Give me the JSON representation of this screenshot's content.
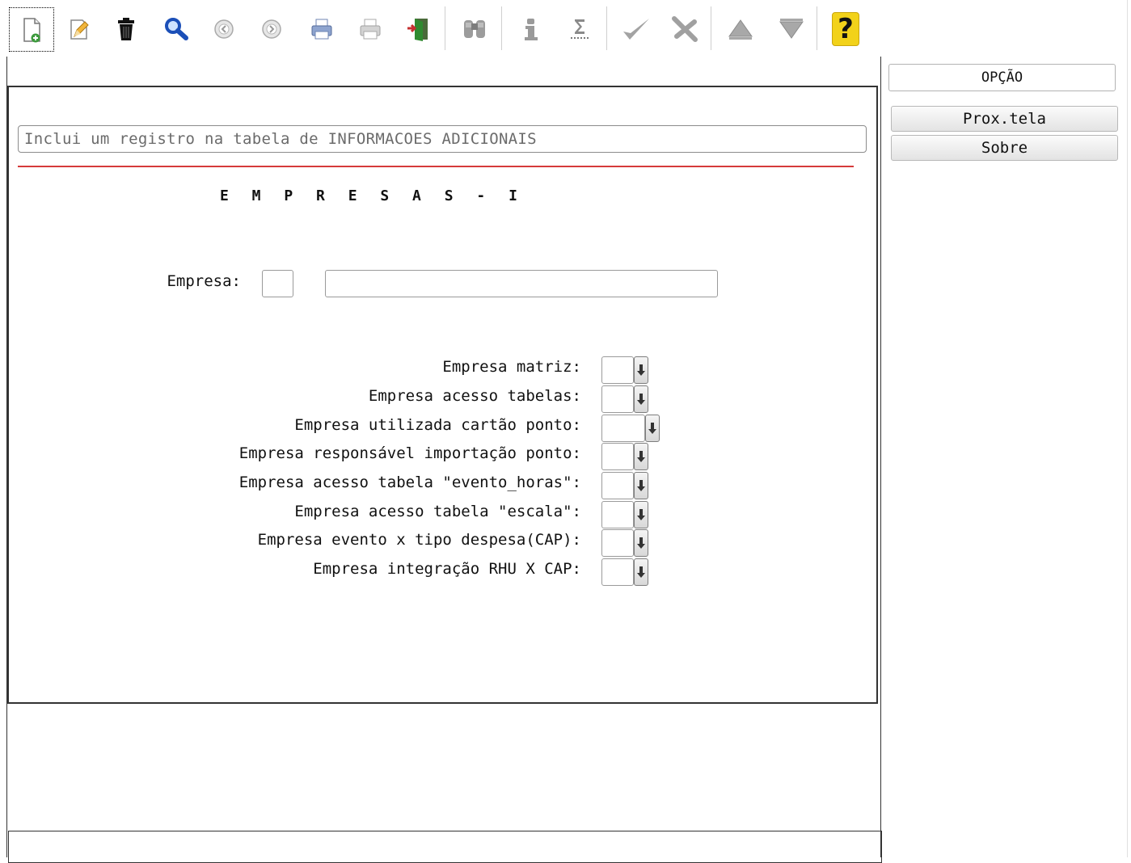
{
  "toolbar": {
    "icons": [
      "new-record-icon",
      "edit-icon",
      "delete-icon",
      "search-icon",
      "previous-icon",
      "next-icon",
      "print-icon",
      "print-preview-icon",
      "exit-icon",
      "binoculars-icon",
      "info-icon",
      "sum-icon",
      "confirm-icon",
      "cancel-icon",
      "first-icon",
      "last-icon",
      "help-icon"
    ],
    "help_symbol": "?"
  },
  "side": {
    "option_label": "OPÇÃO",
    "next_screen_label": "Prox.tela",
    "about_label": "Sobre"
  },
  "form": {
    "description": "Inclui um registro na tabela de INFORMACOES ADICIONAIS",
    "title": "E M P R E S A S - I",
    "company_label": "Empresa:",
    "company_code": "",
    "company_name": "",
    "fields": [
      {
        "label": "Empresa matriz:",
        "value": ""
      },
      {
        "label": "Empresa acesso tabelas:",
        "value": ""
      },
      {
        "label": "Empresa utilizada cartão ponto:",
        "value": ""
      },
      {
        "label": "Empresa responsável importação ponto:",
        "value": ""
      },
      {
        "label": "Empresa acesso tabela \"evento_horas\":",
        "value": ""
      },
      {
        "label": "Empresa acesso tabela \"escala\":",
        "value": ""
      },
      {
        "label": "Empresa evento x tipo despesa(CAP):",
        "value": ""
      },
      {
        "label": "Empresa integração RHU X CAP:",
        "value": ""
      }
    ]
  },
  "colors": {
    "accent_line": "#d53a3a",
    "help_yellow": "#f2d21a"
  }
}
